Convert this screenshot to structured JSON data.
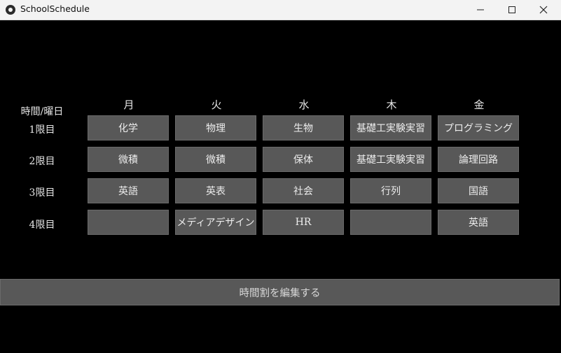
{
  "window": {
    "title": "SchoolSchedule"
  },
  "corner_label": "時間/曜日",
  "days": [
    "月",
    "火",
    "水",
    "木",
    "金"
  ],
  "periods": [
    {
      "label": "1限目",
      "subjects": [
        "化学",
        "物理",
        "生物",
        "基礎工実験実習",
        "プログラミング"
      ]
    },
    {
      "label": "2限目",
      "subjects": [
        "微積",
        "微積",
        "保体",
        "基礎工実験実習",
        "論理回路"
      ]
    },
    {
      "label": "3限目",
      "subjects": [
        "英語",
        "英表",
        "社会",
        "行列",
        "国語"
      ]
    },
    {
      "label": "4限目",
      "subjects": [
        "",
        "メディアデザイン",
        "HR",
        "",
        "英語"
      ]
    }
  ],
  "edit_button_label": "時間割を編集する"
}
